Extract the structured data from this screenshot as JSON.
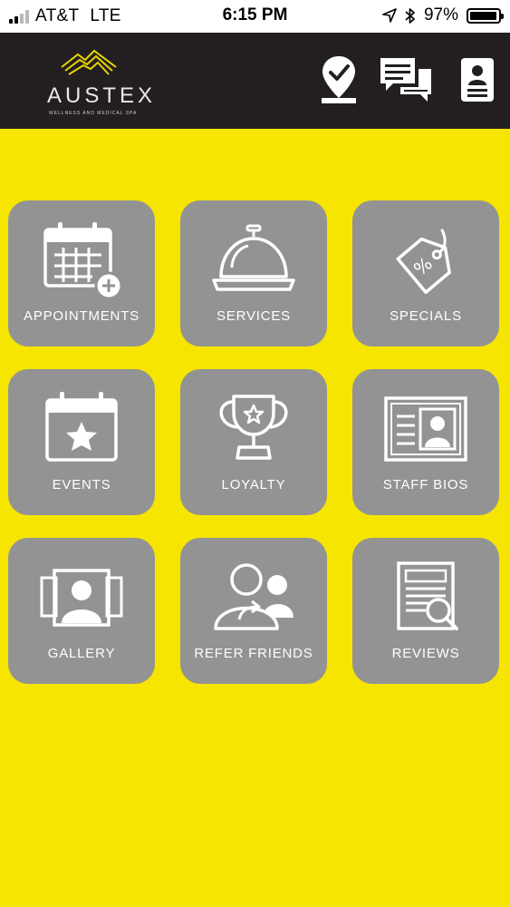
{
  "status_bar": {
    "carrier": "AT&T",
    "network": "LTE",
    "time": "6:15 PM",
    "battery": "97%",
    "signal_bars": 2,
    "signal_total": 4,
    "battery_level": 0.97,
    "icons": [
      "location-arrow-icon",
      "bluetooth-icon",
      "battery-icon"
    ]
  },
  "header": {
    "logo": {
      "name": "AUSTEX",
      "tagline": "WELLNESS AND MEDICAL SPA",
      "mountain_color": "#e7d400"
    },
    "icons": [
      "check-in-icon",
      "messages-icon",
      "profile-icon"
    ],
    "background": "#231f20"
  },
  "menu": {
    "tile_color": "#939393",
    "items": [
      {
        "label": "APPOINTMENTS",
        "icon": "calendar-plus-icon"
      },
      {
        "label": "SERVICES",
        "icon": "service-bell-icon"
      },
      {
        "label": "SPECIALS",
        "icon": "price-tag-icon"
      },
      {
        "label": "EVENTS",
        "icon": "calendar-star-icon"
      },
      {
        "label": "LOYALTY",
        "icon": "trophy-icon"
      },
      {
        "label": "STAFF BIOS",
        "icon": "id-card-icon"
      },
      {
        "label": "GALLERY",
        "icon": "photo-gallery-icon"
      },
      {
        "label": "REFER FRIENDS",
        "icon": "refer-friends-icon"
      },
      {
        "label": "REVIEWS",
        "icon": "reviews-icon"
      }
    ]
  },
  "page": {
    "background": "#f5e500"
  }
}
